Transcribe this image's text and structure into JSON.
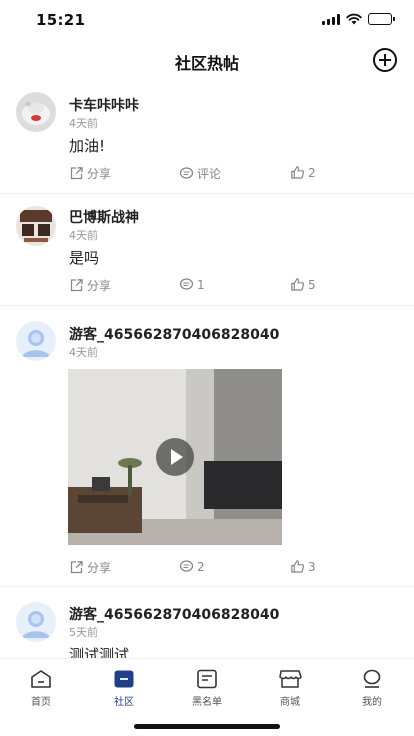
{
  "status_bar": {
    "time": "15:21"
  },
  "nav": {
    "title": "社区热帖"
  },
  "posts": [
    {
      "username": "卡车咔咔咔",
      "time": "4天前",
      "content": "加油!",
      "share_label": "分享",
      "comment_label": "评论",
      "likes": "2",
      "avatar_icon": "user-photo-avatar"
    },
    {
      "username": "巴博斯战神",
      "time": "4天前",
      "content": "是吗",
      "share_label": "分享",
      "comments": "1",
      "likes": "5",
      "avatar_icon": "user-photo-avatar"
    },
    {
      "username": "游客_465662870406828040",
      "time": "4天前",
      "share_label": "分享",
      "comments": "2",
      "likes": "3",
      "avatar_icon": "default-guest-avatar",
      "media_icon": "play-icon"
    },
    {
      "username": "游客_465662870406828040",
      "time": "5天前",
      "content": "测试测试",
      "avatar_icon": "default-guest-avatar"
    }
  ],
  "tabs": [
    {
      "label": "首页",
      "icon": "home-icon",
      "active": false
    },
    {
      "label": "社区",
      "icon": "community-icon",
      "active": true
    },
    {
      "label": "黑名单",
      "icon": "blacklist-icon",
      "active": false
    },
    {
      "label": "商城",
      "icon": "shop-icon",
      "active": false
    },
    {
      "label": "我的",
      "icon": "profile-icon",
      "active": false
    }
  ],
  "colors": {
    "accent": "#1f3f8a",
    "text": "#222222",
    "muted": "#888888",
    "divider": "#eeeeee"
  }
}
